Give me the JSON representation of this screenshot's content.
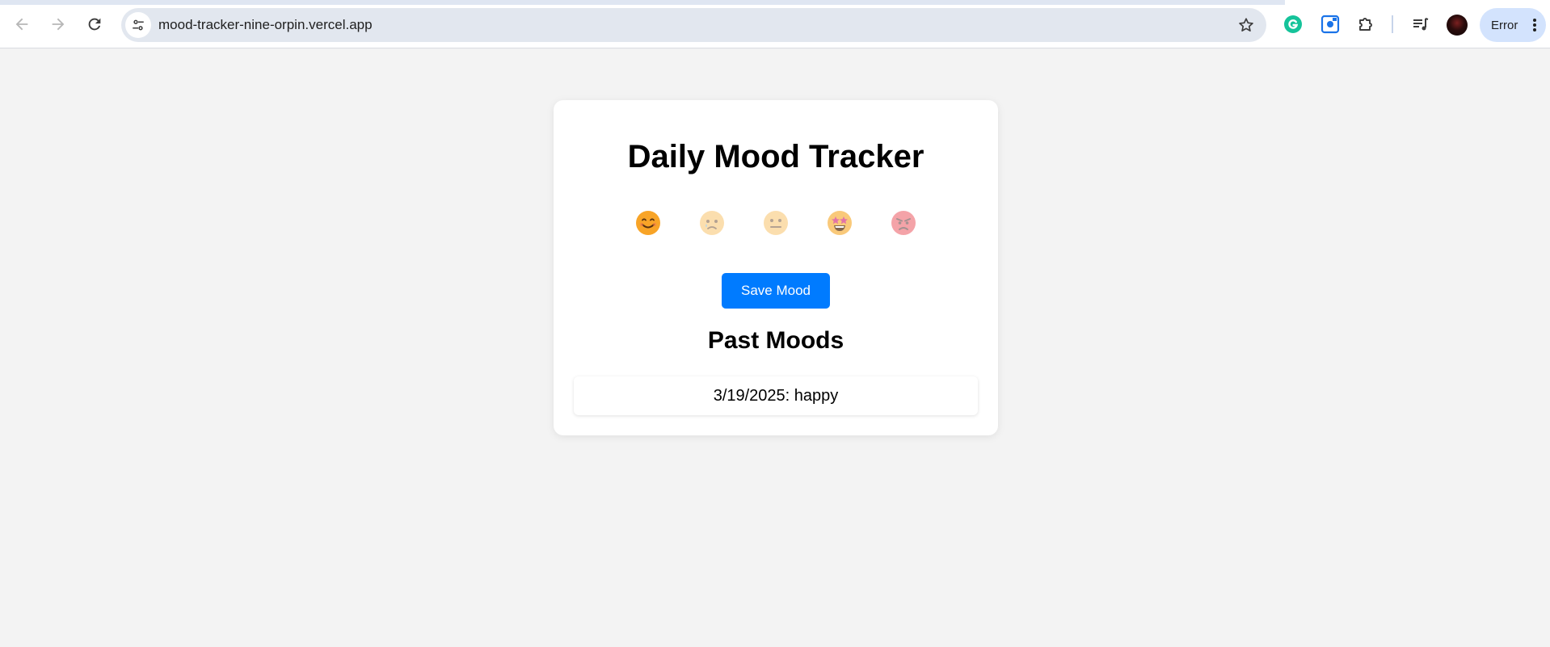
{
  "browser": {
    "url": "mood-tracker-nine-orpin.vercel.app",
    "profile_status": "Error",
    "icons": {
      "back": "arrow-left-icon",
      "forward": "arrow-right-icon",
      "reload": "reload-icon",
      "site_info": "tune-icon",
      "bookmark": "star-icon",
      "grammarly": "grammarly-icon",
      "screen_capture": "screen-capture-icon",
      "extensions": "puzzle-icon",
      "media": "media-queue-icon",
      "menu": "kebab-menu-icon"
    },
    "colors": {
      "accent_chip": "#d3e3fd",
      "omnibox": "#e2e7ef"
    }
  },
  "app": {
    "title": "Daily Mood Tracker",
    "moods": [
      {
        "emoji": "😊",
        "name": "happy",
        "icon": "smiling-face-icon",
        "selected": true
      },
      {
        "emoji": "😢",
        "name": "sad",
        "icon": "crying-face-icon",
        "selected": false
      },
      {
        "emoji": "😐",
        "name": "neutral",
        "icon": "neutral-face-icon",
        "selected": false
      },
      {
        "emoji": "🤩",
        "name": "excited",
        "icon": "star-struck-face-icon",
        "selected": false
      },
      {
        "emoji": "😡",
        "name": "angry",
        "icon": "angry-face-icon",
        "selected": false
      }
    ],
    "save_label": "Save Mood",
    "past_title": "Past Moods",
    "past_moods": [
      "3/19/2025: happy"
    ],
    "colors": {
      "button": "#007bff",
      "background": "#f3f3f3",
      "card": "#ffffff"
    }
  }
}
